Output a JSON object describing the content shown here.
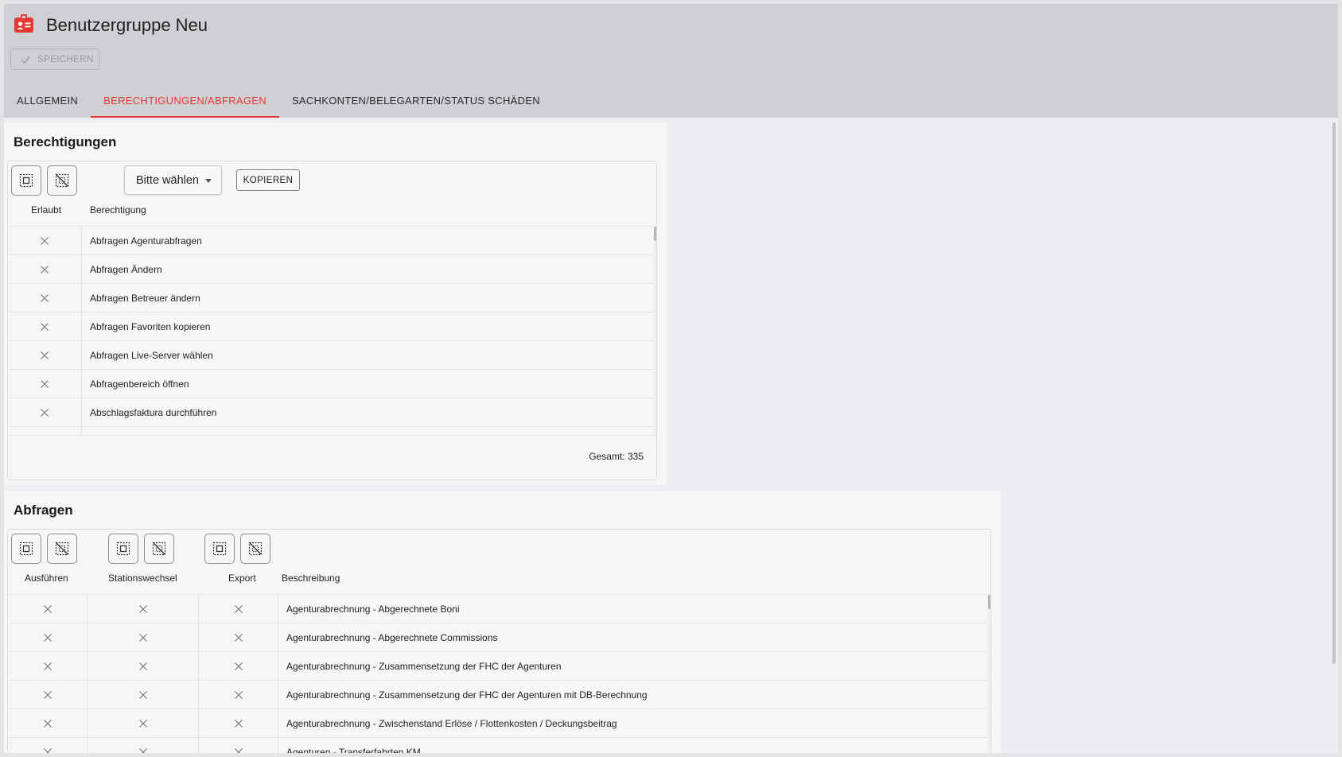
{
  "header": {
    "title": "Benutzergruppe Neu",
    "app_icon": "id-badge-icon",
    "save_label": "SPEICHERN",
    "tabs": [
      {
        "label": "ALLGEMEIN",
        "active": false
      },
      {
        "label": "BERECHTIGUNGEN/ABFRAGEN",
        "active": true
      },
      {
        "label": "SACHKONTEN/BELEGARTEN/STATUS SCHÄDEN",
        "active": false
      }
    ]
  },
  "colors": {
    "accent": "#e53935",
    "header_bg": "#cfd0d3",
    "card_bg": "#f6f6f6"
  },
  "permissions": {
    "title": "Berechtigungen",
    "select_all_icon": "select-all-icon",
    "deselect_all_icon": "deselect-all-icon",
    "group_select": {
      "value": "Bitte wählen"
    },
    "copy_label": "KOPIEREN",
    "columns": [
      "Erlaubt",
      "Berechtigung"
    ],
    "rows": [
      {
        "allowed": false,
        "name": "Abfragen Agenturabfragen"
      },
      {
        "allowed": false,
        "name": "Abfragen Ändern"
      },
      {
        "allowed": false,
        "name": "Abfragen Betreuer ändern"
      },
      {
        "allowed": false,
        "name": "Abfragen Favoriten kopieren"
      },
      {
        "allowed": false,
        "name": "Abfragen Live-Server wählen"
      },
      {
        "allowed": false,
        "name": "Abfragenbereich öffnen"
      },
      {
        "allowed": false,
        "name": "Abschlagsfaktura durchführen"
      }
    ],
    "total_label": "Gesamt: 335"
  },
  "queries": {
    "title": "Abfragen",
    "columns": [
      "Ausführen",
      "Stationswechsel",
      "Export",
      "Beschreibung"
    ],
    "rows": [
      {
        "execute": false,
        "station_change": false,
        "export": false,
        "description": "Agenturabrechnung - Abgerechnete Boni"
      },
      {
        "execute": false,
        "station_change": false,
        "export": false,
        "description": "Agenturabrechnung - Abgerechnete Commissions"
      },
      {
        "execute": false,
        "station_change": false,
        "export": false,
        "description": "Agenturabrechnung - Zusammensetzung der FHC der Agenturen"
      },
      {
        "execute": false,
        "station_change": false,
        "export": false,
        "description": "Agenturabrechnung - Zusammensetzung der FHC der Agenturen mit DB-Berechnung"
      },
      {
        "execute": false,
        "station_change": false,
        "export": false,
        "description": "Agenturabrechnung - Zwischenstand Erlöse / Flottenkosten / Deckungsbeitrag"
      },
      {
        "execute": false,
        "station_change": false,
        "export": false,
        "description": "Agenturen - Transferfahrten KM"
      }
    ]
  }
}
